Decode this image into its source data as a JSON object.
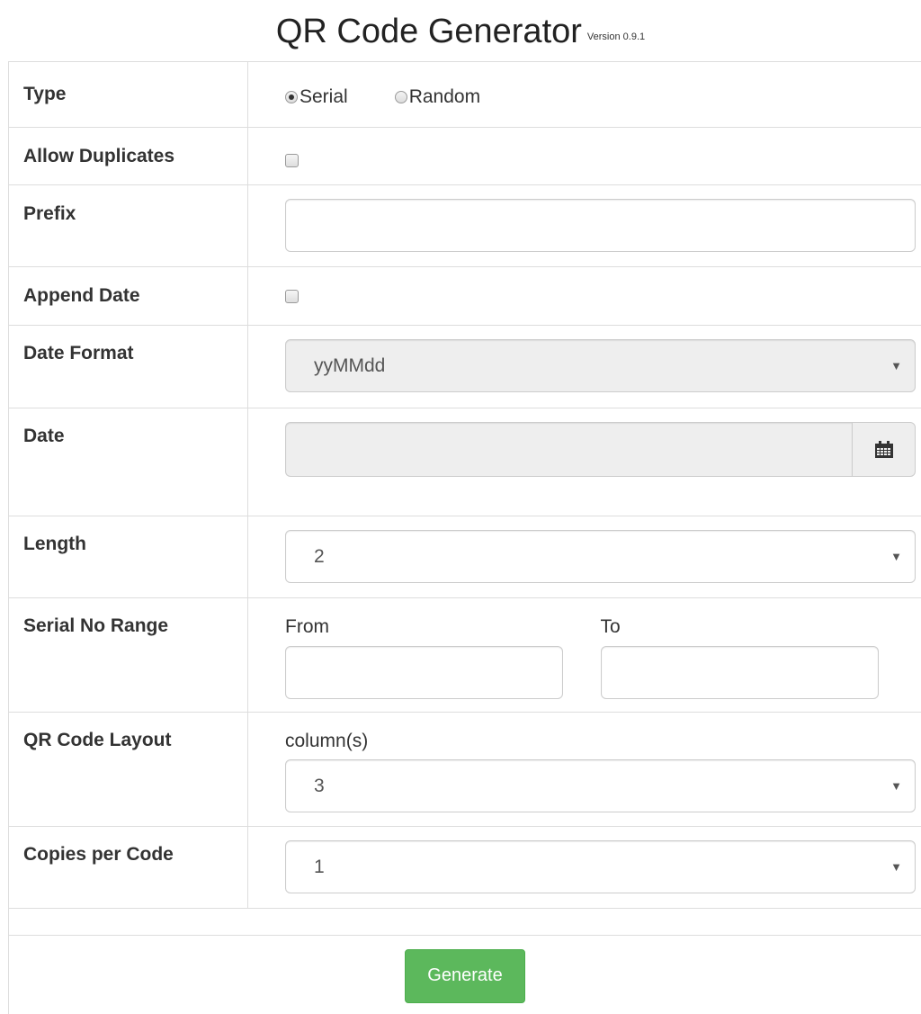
{
  "header": {
    "title": "QR Code Generator",
    "version": "Version 0.9.1"
  },
  "form": {
    "type": {
      "label": "Type",
      "options": [
        {
          "label": "Serial",
          "checked": true
        },
        {
          "label": "Random",
          "checked": false
        }
      ]
    },
    "allow_duplicates": {
      "label": "Allow Duplicates",
      "checked": false
    },
    "prefix": {
      "label": "Prefix",
      "value": ""
    },
    "append_date": {
      "label": "Append Date",
      "checked": false
    },
    "date_format": {
      "label": "Date Format",
      "value": "yyMMdd",
      "disabled": true
    },
    "date": {
      "label": "Date",
      "value": "",
      "disabled": true,
      "icon": "calendar-icon"
    },
    "length": {
      "label": "Length",
      "value": "2"
    },
    "serial_range": {
      "label": "Serial No Range",
      "from_label": "From",
      "to_label": "To",
      "from_value": "",
      "to_value": ""
    },
    "layout": {
      "label": "QR Code Layout",
      "sub_label": "column(s)",
      "value": "3"
    },
    "copies": {
      "label": "Copies per Code",
      "value": "1"
    }
  },
  "actions": {
    "generate_label": "Generate"
  },
  "colors": {
    "primary_button": "#5cb85c",
    "border": "#dddddd",
    "disabled_bg": "#eeeeee"
  }
}
